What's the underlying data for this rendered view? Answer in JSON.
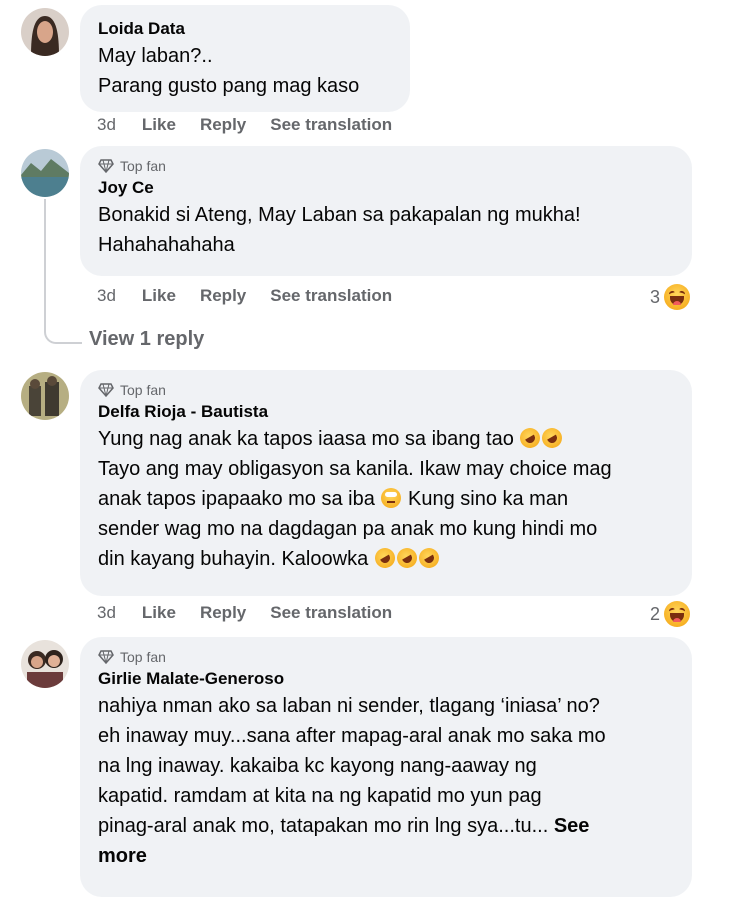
{
  "comments": [
    {
      "name": "Loida Data",
      "top_fan": "",
      "lines": [
        "May laban?..",
        "Parang gusto pang mag kaso"
      ],
      "time": "3d",
      "like": "Like",
      "reply": "Reply",
      "translate": "See translation",
      "reactions": ""
    },
    {
      "name": "Joy Ce",
      "top_fan": "Top fan",
      "lines": [
        "Bonakid si Ateng, May Laban sa pakapalan ng mukha!",
        "Hahahahahaha"
      ],
      "time": "3d",
      "like": "Like",
      "reply": "Reply",
      "translate": "See translation",
      "reactions": "3",
      "view_replies": "View 1 reply"
    },
    {
      "name": "Delfa Rioja - Bautista",
      "top_fan": "Top fan",
      "lines": [
        "Yung nag anak ka tapos iaasa mo sa ibang tao",
        "Tayo ang may obligasyon sa kanila. Ikaw may choice mag",
        "anak tapos ipapaako mo sa iba",
        "Kung sino ka man",
        "sender wag mo na dagdagan pa anak mo kung hindi mo",
        "din kayang buhayin. Kaloowka"
      ],
      "time": "3d",
      "like": "Like",
      "reply": "Reply",
      "translate": "See translation",
      "reactions": "2"
    },
    {
      "name": "Girlie Malate-Generoso",
      "top_fan": "Top fan",
      "lines": [
        "nahiya nman ako sa laban ni sender, tlagang ‘iniasa’ no?",
        "eh inaway muy...sana after mapag-aral anak mo saka mo",
        "na lng inaway. kakaiba kc kayong nang-aaway ng",
        "kapatid. ramdam at kita na ng kapatid mo yun pag",
        "pinag-aral anak mo, tatapakan mo rin lng sya...tu..."
      ],
      "see_more_1": "See",
      "see_more_2": "more"
    }
  ],
  "icons": {
    "top_fan_icon": "diamond-icon",
    "reaction_icon": "laughing-emoji-icon",
    "inline_emoji_1": "rolling-on-floor-laughing-emoji",
    "inline_emoji_2": "eye-roll-emoji"
  },
  "colors": {
    "bubble": "#f0f2f5",
    "secondary_text": "#65676b",
    "primary_text": "#050505"
  }
}
